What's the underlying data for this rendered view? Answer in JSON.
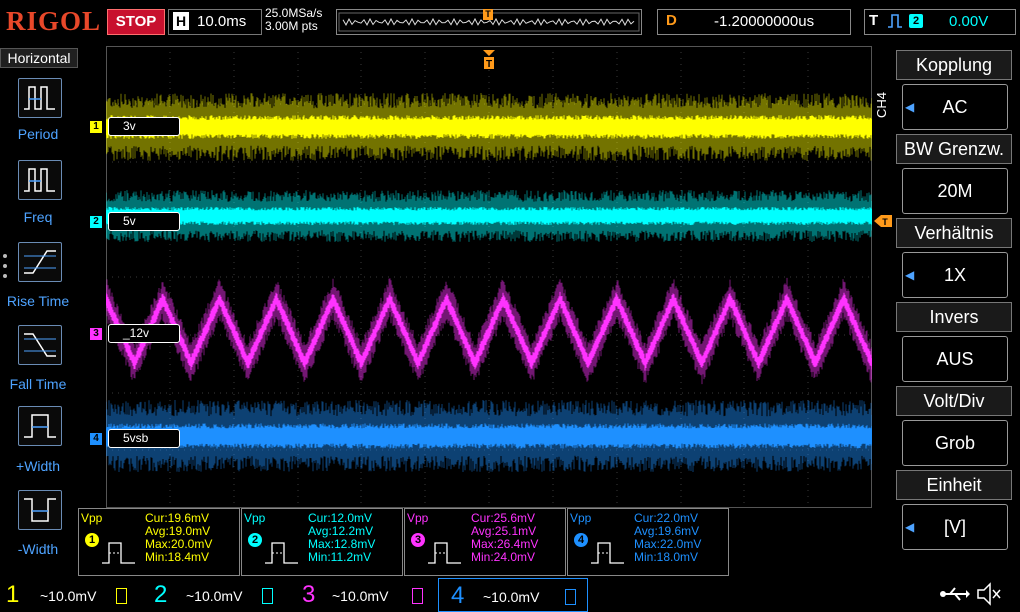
{
  "topbar": {
    "brand": "RIGOL",
    "run_state": "STOP",
    "h_label": "H",
    "timebase": "10.0ms",
    "sample_rate": "25.0MSa/s",
    "mem_depth": "3.00M pts",
    "trigger_marker": "T",
    "delay_label": "D",
    "delay_value": "-1.20000000us",
    "trigger_label": "T",
    "trigger_channel": "2",
    "trigger_level": "0.00V"
  },
  "left_panel": {
    "title": "Horizontal",
    "items": [
      {
        "label": "Period"
      },
      {
        "label": "Freq"
      },
      {
        "label": "Rise Time"
      },
      {
        "label": "Fall Time"
      },
      {
        "label": "+Width"
      },
      {
        "label": "-Width"
      }
    ]
  },
  "channels": [
    {
      "num": "1",
      "label": "3v",
      "color": "#ffff00",
      "scale": "~10.0mV"
    },
    {
      "num": "2",
      "label": "5v",
      "color": "#00ffff",
      "scale": "~10.0mV"
    },
    {
      "num": "3",
      "label": "_12v",
      "color": "#ff33ff",
      "scale": "~10.0mV"
    },
    {
      "num": "4",
      "label": "5vsb",
      "color": "#1e90ff",
      "scale": "~10.0mV"
    }
  ],
  "right_menu": {
    "channel": "CH4",
    "items": [
      {
        "title": "Kopplung",
        "value": "AC"
      },
      {
        "title": "BW Grenzw.",
        "value": "20M"
      },
      {
        "title": "Verhältnis",
        "value": "1X"
      },
      {
        "title": "Invers",
        "value": "AUS"
      },
      {
        "title": "Volt/Div",
        "value": "Grob"
      },
      {
        "title": "Einheit",
        "value": "[V]"
      }
    ]
  },
  "measurements": [
    {
      "type": "Vpp",
      "ch": "1",
      "cur": "Cur:19.6mV",
      "avg": "Avg:19.0mV",
      "max": "Max:20.0mV",
      "min": "Min:18.4mV"
    },
    {
      "type": "Vpp",
      "ch": "2",
      "cur": "Cur:12.0mV",
      "avg": "Avg:12.2mV",
      "max": "Max:12.8mV",
      "min": "Min:11.2mV"
    },
    {
      "type": "Vpp",
      "ch": "3",
      "cur": "Cur:25.6mV",
      "avg": "Avg:25.1mV",
      "max": "Max:26.4mV",
      "min": "Min:24.0mV"
    },
    {
      "type": "Vpp",
      "ch": "4",
      "cur": "Cur:22.0mV",
      "avg": "Avg:19.6mV",
      "max": "Max:22.0mV",
      "min": "Min:18.0mV"
    }
  ],
  "icons": {
    "usb": "usb-icon",
    "speaker": "speaker-mute-icon"
  }
}
